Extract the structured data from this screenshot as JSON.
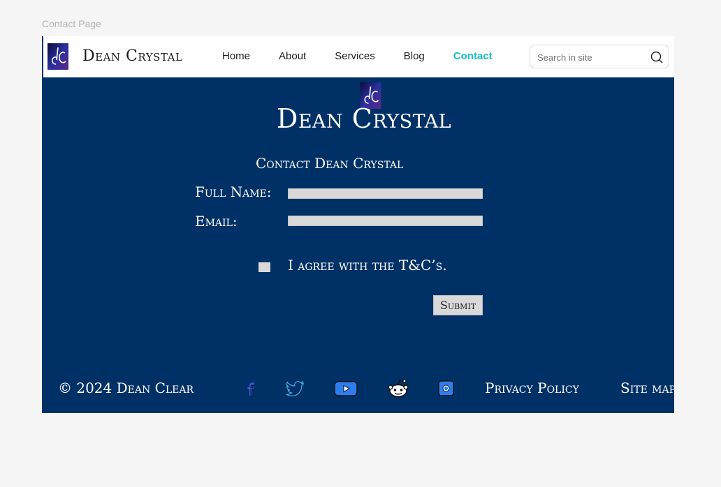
{
  "page_caption": "Contact Page",
  "header": {
    "brand": "Dean Crystal",
    "nav": [
      {
        "label": "Home"
      },
      {
        "label": "About"
      },
      {
        "label": "Services"
      },
      {
        "label": "Blog"
      },
      {
        "label": "Contact",
        "active": true
      }
    ],
    "search": {
      "placeholder": "Search in site",
      "value": ""
    }
  },
  "hero": {
    "title": "Dean Crystal"
  },
  "form": {
    "title": "Contact Dean Crystal",
    "full_name_label": "Full Name:",
    "email_label": "Email:",
    "agree_label": "I agree with the T&C’s.",
    "submit_label": "Submit"
  },
  "footer": {
    "copyright": "© 2024 Dean Clear",
    "social_icons": [
      "facebook-icon",
      "twitter-icon",
      "youtube-icon",
      "reddit-icon",
      "instagram-icon"
    ],
    "privacy_label": "Privacy Policy",
    "sitemap_label": "Site map"
  },
  "colors": {
    "background": "#003166",
    "accent": "#14c0c8",
    "page": "#f5f5f5"
  }
}
